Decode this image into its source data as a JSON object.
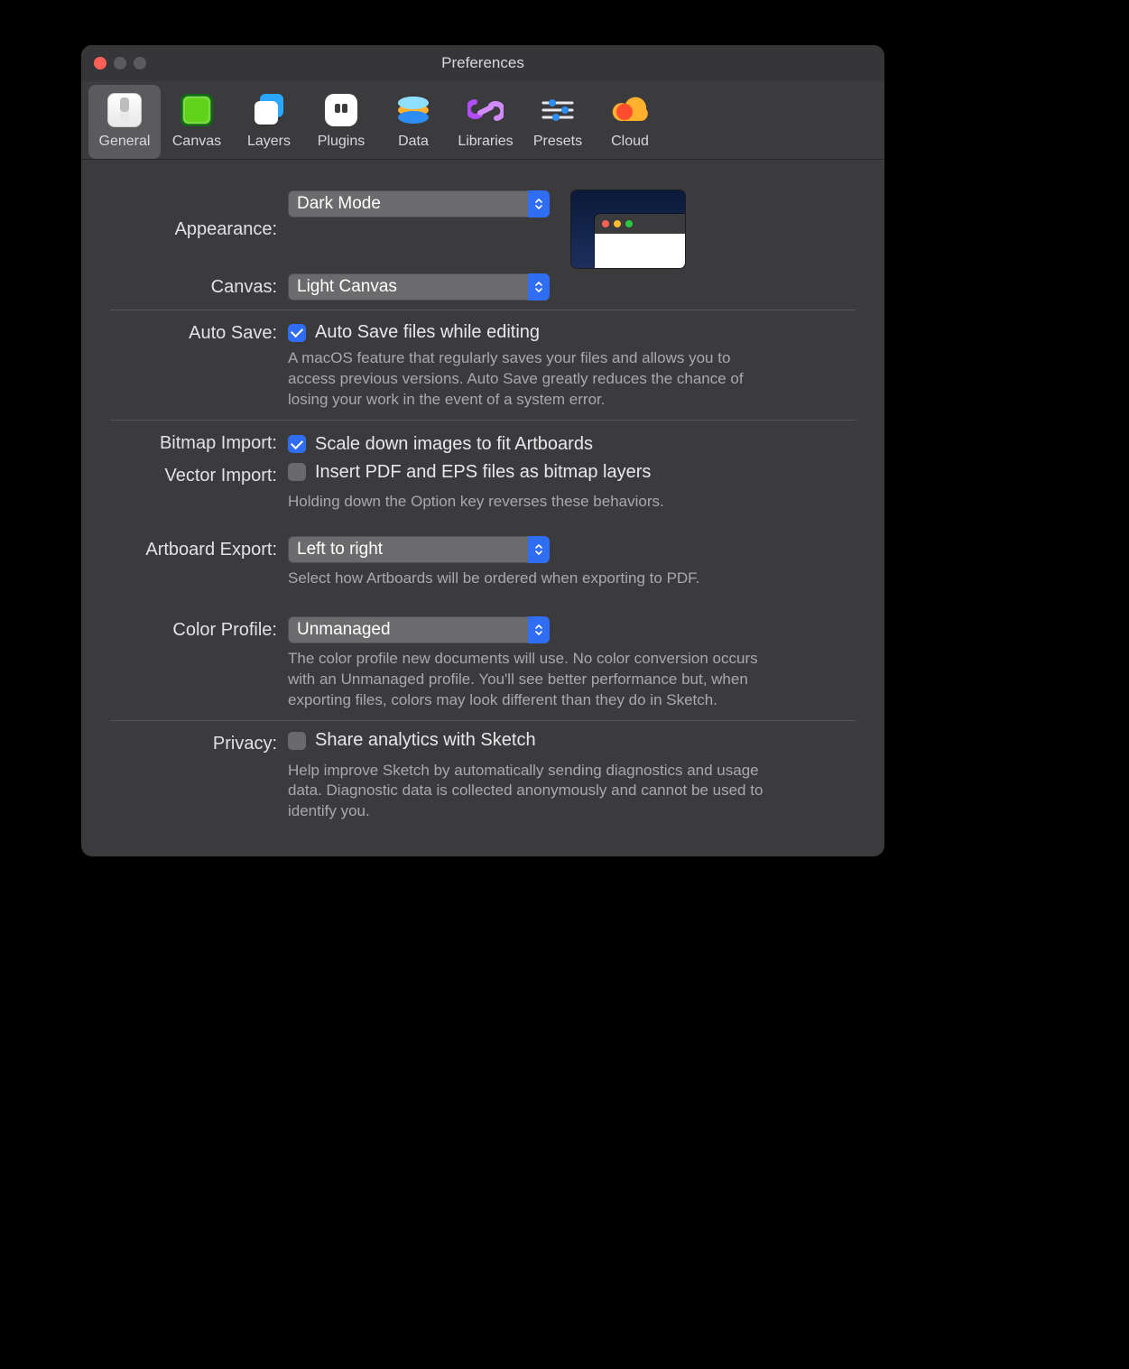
{
  "window": {
    "title": "Preferences"
  },
  "toolbar": {
    "tabs": {
      "general": {
        "label": "General",
        "selected": true
      },
      "canvas": {
        "label": "Canvas",
        "selected": false
      },
      "layers": {
        "label": "Layers",
        "selected": false
      },
      "plugins": {
        "label": "Plugins",
        "selected": false
      },
      "data": {
        "label": "Data",
        "selected": false
      },
      "libraries": {
        "label": "Libraries",
        "selected": false
      },
      "presets": {
        "label": "Presets",
        "selected": false
      },
      "cloud": {
        "label": "Cloud",
        "selected": false
      }
    }
  },
  "appearance": {
    "label": "Appearance:",
    "value": "Dark Mode"
  },
  "canvas": {
    "label": "Canvas:",
    "value": "Light Canvas"
  },
  "autosave": {
    "label": "Auto Save:",
    "checkbox_label": "Auto Save files while editing",
    "checked": true,
    "help": "A macOS feature that regularly saves your files and allows you to access previous versions. Auto Save greatly reduces the chance of losing your work in the event of a system error."
  },
  "bitmap_import": {
    "label": "Bitmap Import:",
    "checkbox_label": "Scale down images to fit Artboards",
    "checked": true
  },
  "vector_import": {
    "label": "Vector Import:",
    "checkbox_label": "Insert PDF and EPS files as bitmap layers",
    "checked": false,
    "help": "Holding down the Option key reverses these behaviors."
  },
  "artboard_export": {
    "label": "Artboard Export:",
    "value": "Left to right",
    "help": "Select how Artboards will be ordered when exporting to PDF."
  },
  "color_profile": {
    "label": "Color Profile:",
    "value": "Unmanaged",
    "help": "The color profile new documents will use. No color conversion occurs with an Unmanaged profile. You'll see better performance but, when exporting files, colors may look different than they do in Sketch."
  },
  "privacy": {
    "label": "Privacy:",
    "checkbox_label": "Share analytics with Sketch",
    "checked": false,
    "help": "Help improve Sketch by automatically sending diagnostics and usage data. Diagnostic data is collected anonymously and cannot be used to identify you."
  }
}
